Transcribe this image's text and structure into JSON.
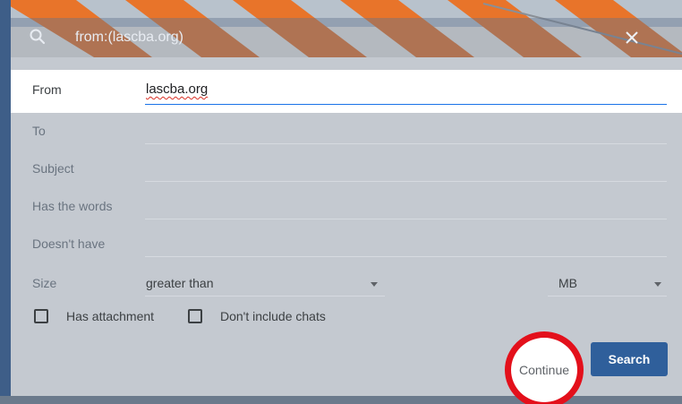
{
  "search_bar": {
    "query": "from:(lascba.org)",
    "search_icon": "search-icon",
    "close_icon": "close-icon"
  },
  "form": {
    "from_label": "From",
    "from_value": "lascba.org",
    "to_label": "To",
    "subject_label": "Subject",
    "has_words_label": "Has the words",
    "doesnt_have_label": "Doesn't have",
    "size_label": "Size",
    "size_operator": "greater than",
    "size_unit": "MB",
    "has_attachment_label": "Has attachment",
    "no_chats_label": "Don't include chats"
  },
  "buttons": {
    "continue_label": "Continue",
    "search_label": "Search"
  },
  "colors": {
    "search_button": "#2f5f9b",
    "highlight_circle": "#e3101b",
    "background_stripes": "#e8742a"
  }
}
